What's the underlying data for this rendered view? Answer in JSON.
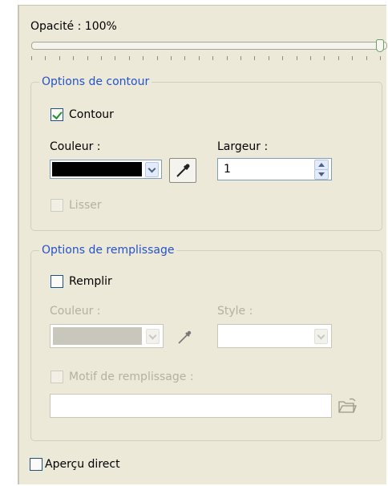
{
  "opacity": {
    "label": "Opacité : 100%",
    "value_percent": 100
  },
  "contour_group": {
    "legend": "Options de contour",
    "contour_checkbox": {
      "label": "Contour",
      "checked": true
    },
    "color_label": "Couleur :",
    "color_value": "#000000",
    "width_label": "Largeur :",
    "width_value": "1",
    "smooth_checkbox": {
      "label": "Lisser",
      "checked": false,
      "enabled": false
    }
  },
  "fill_group": {
    "legend": "Options de remplissage",
    "fill_checkbox": {
      "label": "Remplir",
      "checked": false
    },
    "color_label": "Couleur :",
    "color_value": "#c9c7bb",
    "style_label": "Style :",
    "style_value": "",
    "pattern_checkbox": {
      "label": "Motif de remplissage :",
      "checked": false,
      "enabled": false
    },
    "pattern_path": ""
  },
  "live_preview": {
    "label": "Aperçu direct",
    "checked": false
  },
  "colors": {
    "accent": "#2453c8",
    "panel": "#ece9d8",
    "check": "#1d8f2c"
  }
}
